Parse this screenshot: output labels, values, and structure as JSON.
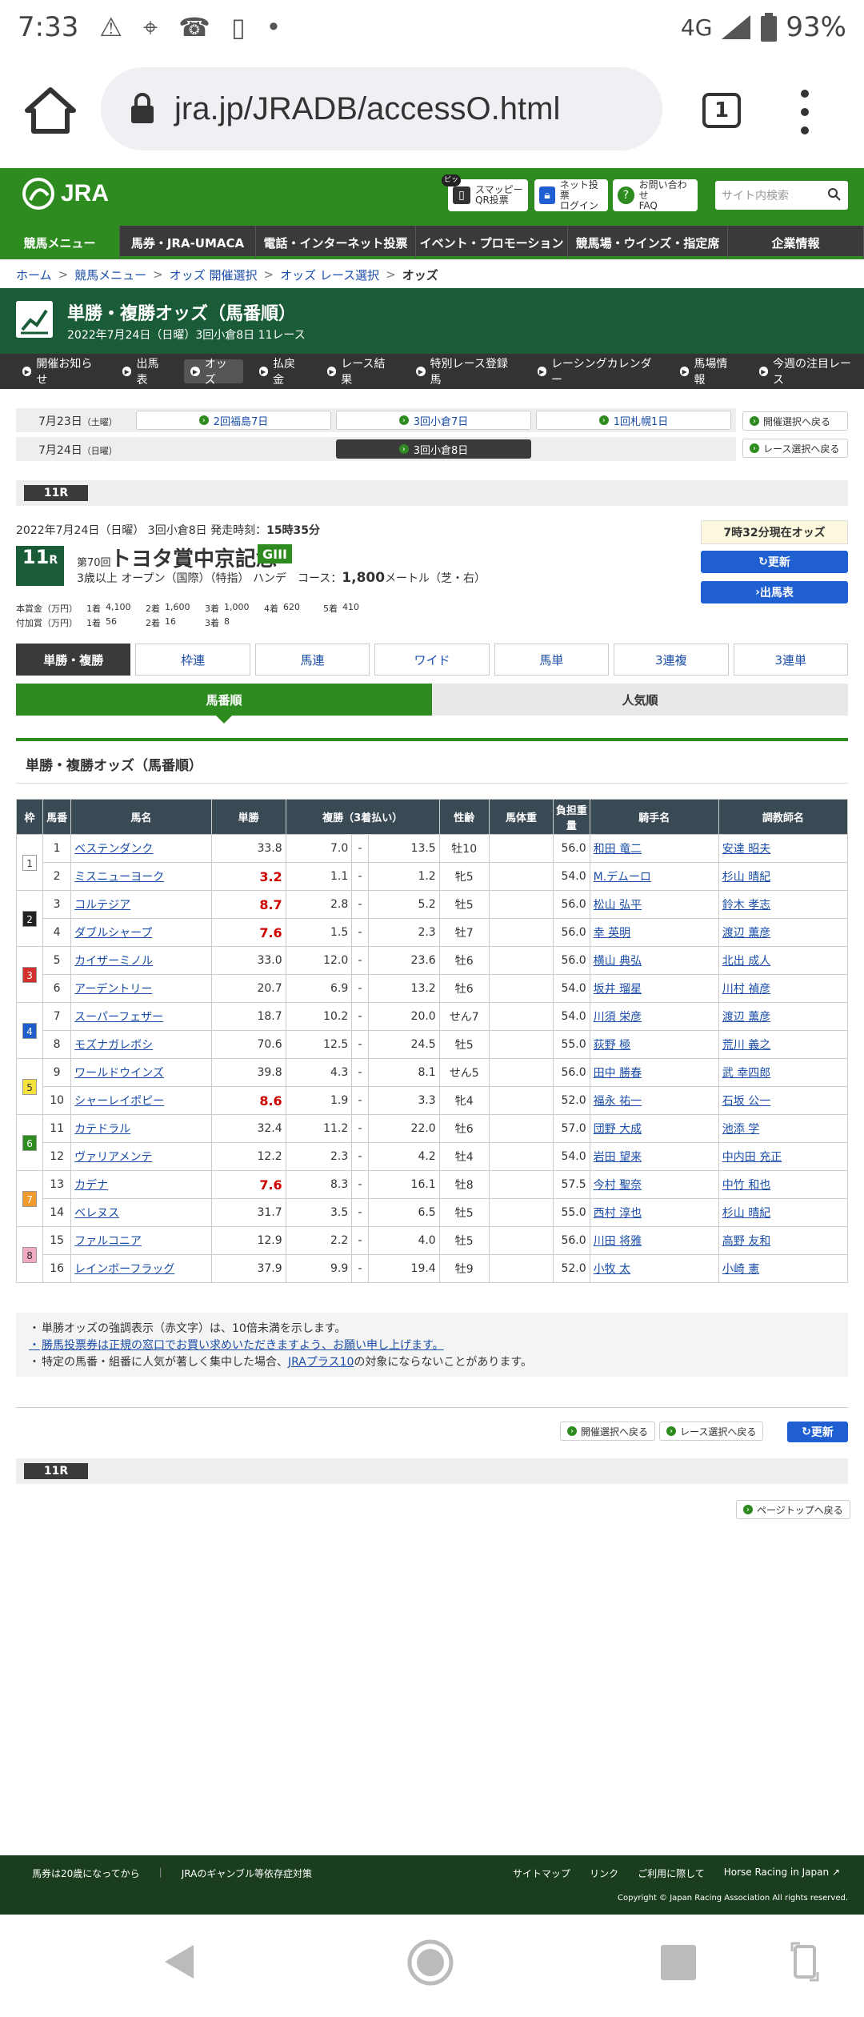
{
  "status": {
    "time": "7:33",
    "network": "4G",
    "battery": "93%"
  },
  "browser": {
    "url": "jra.jp/JRADB/accessO.html",
    "tab_count": "1"
  },
  "header": {
    "logo": "JRA",
    "smapi": {
      "badge": "ピッ",
      "line1": "スマッピー",
      "line2": "QR投票"
    },
    "netvote": {
      "line1": "ネット投票",
      "line2": "ログイン"
    },
    "contact": {
      "line1": "お問い合わせ",
      "line2": "FAQ"
    },
    "search_placeholder": "サイト内検索"
  },
  "mainnav": [
    "競馬メニュー",
    "馬券・JRA-UMACA",
    "電話・インターネット投票",
    "イベント・プロモーション",
    "競馬場・ウインズ・指定席",
    "企業情報"
  ],
  "breadcrumb": [
    "ホーム",
    "競馬メニュー",
    "オッズ 開催選択",
    "オッズ レース選択",
    "オッズ"
  ],
  "title": {
    "main": "単勝・複勝オッズ（馬番順）",
    "sub": "2022年7月24日（日曜）3回小倉8日 11レース"
  },
  "subnav": [
    "開催お知らせ",
    "出馬表",
    "オッズ",
    "払戻金",
    "レース結果",
    "特別レース登録馬",
    "レーシングカレンダー",
    "馬場情報",
    "今週の注目レース"
  ],
  "days": {
    "d1": {
      "date": "7月23日",
      "dow": "（土曜）",
      "venues": [
        "2回福島7日",
        "3回小倉7日",
        "1回札幌1日"
      ]
    },
    "d2": {
      "date": "7月24日",
      "dow": "（日曜）",
      "venue": "3回小倉8日"
    },
    "back_kaisai": "開催選択へ戻る",
    "back_race": "レース選択へ戻る"
  },
  "race": {
    "tag": "11R",
    "date_line": "2022年7月24日（日曜） 3回小倉8日 発走時刻：",
    "start_time": "15時35分",
    "num": "11",
    "num_suffix": "R",
    "ordinal": "第70回",
    "name": "トヨタ賞中京記念",
    "grade": "GIII",
    "conditions": "3歳以上 オープン（国際）（特指） ハンデ",
    "course_label": "コース：",
    "course_dist": "1,800",
    "course_unit": "メートル（芝・右）",
    "odds_time": "7時32分現在オッズ",
    "refresh": "更新",
    "entries": "出馬表"
  },
  "prize": {
    "label1": "本賞金（万円）",
    "p1": [
      "1着",
      "4,100",
      "2着",
      "1,600",
      "3着",
      "1,000",
      "4着",
      "620",
      "5着",
      "410"
    ],
    "label2": "付加賞（万円）",
    "p2": [
      "1着",
      "56",
      "2着",
      "16",
      "3着",
      "8"
    ]
  },
  "betnav": [
    "単勝・複勝",
    "枠連",
    "馬連",
    "ワイド",
    "馬単",
    "3連複",
    "3連単"
  ],
  "sorttabs": [
    "馬番順",
    "人気順"
  ],
  "section_title": "単勝・複勝オッズ（馬番順）",
  "table": {
    "headers": [
      "枠",
      "馬番",
      "馬名",
      "単勝",
      "複勝（3着払い）",
      "性齢",
      "馬体重",
      "負担重量",
      "騎手名",
      "調教師名"
    ],
    "rows": [
      {
        "waku": "1",
        "num": "1",
        "name": "ベステンダンク",
        "win": "33.8",
        "pmin": "7.0",
        "pmax": "13.5",
        "sex": "牡10",
        "weight": "",
        "load": "56.0",
        "jockey": "和田 竜二",
        "trainer": "安達 昭夫",
        "hot": false
      },
      {
        "waku": "",
        "num": "2",
        "name": "ミスニューヨーク",
        "win": "3.2",
        "pmin": "1.1",
        "pmax": "1.2",
        "sex": "牝5",
        "weight": "",
        "load": "54.0",
        "jockey": "M.デムーロ",
        "trainer": "杉山 晴紀",
        "hot": true
      },
      {
        "waku": "2",
        "num": "3",
        "name": "コルテジア",
        "win": "8.7",
        "pmin": "2.8",
        "pmax": "5.2",
        "sex": "牡5",
        "weight": "",
        "load": "56.0",
        "jockey": "松山 弘平",
        "trainer": "鈴木 孝志",
        "hot": true
      },
      {
        "waku": "",
        "num": "4",
        "name": "ダブルシャープ",
        "win": "7.6",
        "pmin": "1.5",
        "pmax": "2.3",
        "sex": "牡7",
        "weight": "",
        "load": "56.0",
        "jockey": "幸 英明",
        "trainer": "渡辺 薫彦",
        "hot": true
      },
      {
        "waku": "3",
        "num": "5",
        "name": "カイザーミノル",
        "win": "33.0",
        "pmin": "12.0",
        "pmax": "23.6",
        "sex": "牡6",
        "weight": "",
        "load": "56.0",
        "jockey": "横山 典弘",
        "trainer": "北出 成人",
        "hot": false
      },
      {
        "waku": "",
        "num": "6",
        "name": "アーデントリー",
        "win": "20.7",
        "pmin": "6.9",
        "pmax": "13.2",
        "sex": "牡6",
        "weight": "",
        "load": "54.0",
        "jockey": "坂井 瑠星",
        "trainer": "川村 禎彦",
        "hot": false
      },
      {
        "waku": "4",
        "num": "7",
        "name": "スーパーフェザー",
        "win": "18.7",
        "pmin": "10.2",
        "pmax": "20.0",
        "sex": "せん7",
        "weight": "",
        "load": "54.0",
        "jockey": "川須 栄彦",
        "trainer": "渡辺 薫彦",
        "hot": false
      },
      {
        "waku": "",
        "num": "8",
        "name": "モズナガレボシ",
        "win": "70.6",
        "pmin": "12.5",
        "pmax": "24.5",
        "sex": "牡5",
        "weight": "",
        "load": "55.0",
        "jockey": "荻野 極",
        "trainer": "荒川 義之",
        "hot": false
      },
      {
        "waku": "5",
        "num": "9",
        "name": "ワールドウインズ",
        "win": "39.8",
        "pmin": "4.3",
        "pmax": "8.1",
        "sex": "せん5",
        "weight": "",
        "load": "56.0",
        "jockey": "田中 勝春",
        "trainer": "武 幸四郎",
        "hot": false
      },
      {
        "waku": "",
        "num": "10",
        "name": "シャーレイポピー",
        "win": "8.6",
        "pmin": "1.9",
        "pmax": "3.3",
        "sex": "牝4",
        "weight": "",
        "load": "52.0",
        "jockey": "福永 祐一",
        "trainer": "石坂 公一",
        "hot": true
      },
      {
        "waku": "6",
        "num": "11",
        "name": "カテドラル",
        "win": "32.4",
        "pmin": "11.2",
        "pmax": "22.0",
        "sex": "牡6",
        "weight": "",
        "load": "57.0",
        "jockey": "団野 大成",
        "trainer": "池添 学",
        "hot": false
      },
      {
        "waku": "",
        "num": "12",
        "name": "ヴァリアメンテ",
        "win": "12.2",
        "pmin": "2.3",
        "pmax": "4.2",
        "sex": "牡4",
        "weight": "",
        "load": "54.0",
        "jockey": "岩田 望来",
        "trainer": "中内田 充正",
        "hot": false
      },
      {
        "waku": "7",
        "num": "13",
        "name": "カデナ",
        "win": "7.6",
        "pmin": "8.3",
        "pmax": "16.1",
        "sex": "牡8",
        "weight": "",
        "load": "57.5",
        "jockey": "今村 聖奈",
        "trainer": "中竹 和也",
        "hot": true
      },
      {
        "waku": "",
        "num": "14",
        "name": "ベレヌス",
        "win": "31.7",
        "pmin": "3.5",
        "pmax": "6.5",
        "sex": "牡5",
        "weight": "",
        "load": "55.0",
        "jockey": "西村 淳也",
        "trainer": "杉山 晴紀",
        "hot": false
      },
      {
        "waku": "8",
        "num": "15",
        "name": "ファルコニア",
        "win": "12.9",
        "pmin": "2.2",
        "pmax": "4.0",
        "sex": "牡5",
        "weight": "",
        "load": "56.0",
        "jockey": "川田 将雅",
        "trainer": "高野 友和",
        "hot": false
      },
      {
        "waku": "",
        "num": "16",
        "name": "レインボーフラッグ",
        "win": "37.9",
        "pmin": "9.9",
        "pmax": "19.4",
        "sex": "牡9",
        "weight": "",
        "load": "52.0",
        "jockey": "小牧 太",
        "trainer": "小崎 憲",
        "hot": false
      }
    ]
  },
  "notes": {
    "n1": "単勝オッズの強調表示（赤文字）は、10倍未満を示します。",
    "n2": "勝馬投票券は正規の窓口でお買い求めいただきますよう、お願い申し上げます。",
    "n3_link": "JRAプラス10",
    "n3_pre": "特定の馬番・組番に人気が著しく集中した場合、",
    "n3_post": "の対象にならないことがあります。"
  },
  "bottom": {
    "back_kaisai": "開催選択へ戻る",
    "back_race": "レース選択へ戻る",
    "refresh": "更新",
    "tag": "11R",
    "page_top": "ページトップへ戻る"
  },
  "footer": {
    "left": [
      "馬券は20歳になってから",
      "JRAのギャンブル等依存症対策"
    ],
    "right": [
      "サイトマップ",
      "リンク",
      "ご利用に際して",
      "Horse Racing in Japan"
    ],
    "copyright": "Copyright © Japan Racing Association All rights reserved."
  },
  "colors": {
    "jra_green": "#2e8b1f",
    "dark_green": "#1a5c38",
    "red": "#cc0000",
    "blue": "#1f5fd1"
  },
  "waku_colors": {
    "1": "#ffffff",
    "2": "#222222",
    "3": "#d32f2f",
    "4": "#1e5dcc",
    "5": "#f5e23b",
    "6": "#2e8b1f",
    "7": "#f39a2c",
    "8": "#f2a9c4"
  }
}
